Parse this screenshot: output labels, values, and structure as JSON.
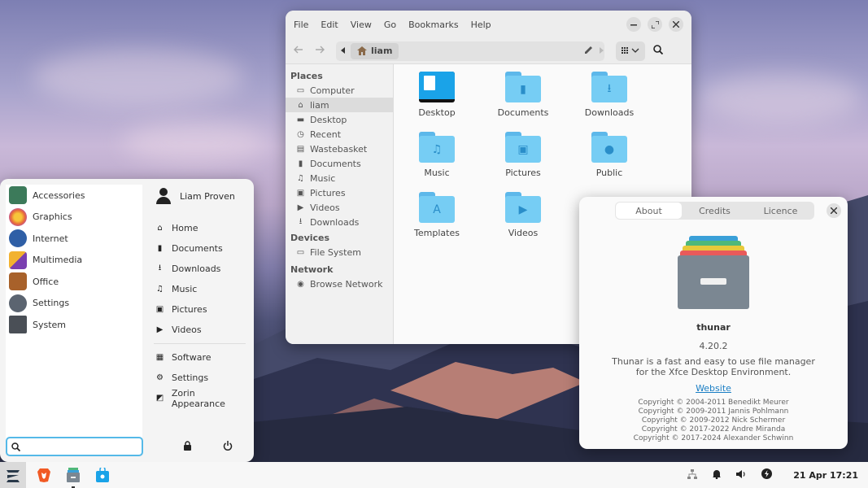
{
  "file_manager": {
    "menus": [
      "File",
      "Edit",
      "View",
      "Go",
      "Bookmarks",
      "Help"
    ],
    "path": "liam",
    "sidebar": {
      "places_heading": "Places",
      "places": [
        {
          "label": "Computer",
          "icon": "computer-icon"
        },
        {
          "label": "liam",
          "icon": "home-icon",
          "active": true
        },
        {
          "label": "Desktop",
          "icon": "desktop-icon"
        },
        {
          "label": "Recent",
          "icon": "clock-icon"
        },
        {
          "label": "Wastebasket",
          "icon": "trash-icon"
        },
        {
          "label": "Documents",
          "icon": "document-icon"
        },
        {
          "label": "Music",
          "icon": "music-icon"
        },
        {
          "label": "Pictures",
          "icon": "picture-icon"
        },
        {
          "label": "Videos",
          "icon": "video-icon"
        },
        {
          "label": "Downloads",
          "icon": "download-icon"
        }
      ],
      "devices_heading": "Devices",
      "devices": [
        {
          "label": "File System",
          "icon": "drive-icon"
        }
      ],
      "network_heading": "Network",
      "network": [
        {
          "label": "Browse Network",
          "icon": "network-icon"
        }
      ]
    },
    "folders": [
      {
        "label": "Desktop",
        "icon": "desktop-folder-icon"
      },
      {
        "label": "Documents",
        "icon": "documents-folder-icon"
      },
      {
        "label": "Downloads",
        "icon": "downloads-folder-icon"
      },
      {
        "label": "Music",
        "icon": "music-folder-icon"
      },
      {
        "label": "Pictures",
        "icon": "pictures-folder-icon"
      },
      {
        "label": "Public",
        "icon": "public-folder-icon"
      },
      {
        "label": "Templates",
        "icon": "templates-folder-icon"
      },
      {
        "label": "Videos",
        "icon": "videos-folder-icon"
      }
    ]
  },
  "about": {
    "tabs": [
      "About",
      "Credits",
      "Licence"
    ],
    "app_name": "thunar",
    "version": "4.20.2",
    "description_line1": "Thunar is a fast and easy to use file manager",
    "description_line2": "for the Xfce Desktop Environment.",
    "website": "Website",
    "copyrights": [
      "Copyright © 2004-2011 Benedikt Meurer",
      "Copyright © 2009-2011 Jannis Pohlmann",
      "Copyright © 2009-2012 Nick Schermer",
      "Copyright © 2017-2022 Andre Miranda",
      "Copyright © 2017-2024 Alexander Schwinn"
    ]
  },
  "start_menu": {
    "categories": [
      {
        "label": "Accessories",
        "icon": "accessories-icon",
        "color": "#3c7a5a"
      },
      {
        "label": "Graphics",
        "icon": "graphics-icon",
        "color": "#e86a3a"
      },
      {
        "label": "Internet",
        "icon": "internet-icon",
        "color": "#2f5fa6"
      },
      {
        "label": "Multimedia",
        "icon": "multimedia-icon",
        "color": "#7a3fb0"
      },
      {
        "label": "Office",
        "icon": "office-icon",
        "color": "#a8612a"
      },
      {
        "label": "Settings",
        "icon": "settings-icon",
        "color": "#5b6470"
      },
      {
        "label": "System",
        "icon": "system-icon",
        "color": "#4a4f56"
      }
    ],
    "user_name": "Liam Proven",
    "places": [
      {
        "label": "Home",
        "icon": "home-icon"
      },
      {
        "label": "Documents",
        "icon": "document-icon"
      },
      {
        "label": "Downloads",
        "icon": "download-icon"
      },
      {
        "label": "Music",
        "icon": "music-icon"
      },
      {
        "label": "Pictures",
        "icon": "picture-icon"
      },
      {
        "label": "Videos",
        "icon": "video-icon"
      }
    ],
    "apps": [
      {
        "label": "Software",
        "icon": "software-icon"
      },
      {
        "label": "Settings",
        "icon": "gear-icon"
      },
      {
        "label": "Zorin Appearance",
        "icon": "appearance-icon"
      }
    ],
    "search_value": ""
  },
  "taskbar": {
    "clock": "21 Apr 17:21"
  },
  "colors": {
    "accent": "#55b9e8",
    "folder": "#76cdf4"
  }
}
